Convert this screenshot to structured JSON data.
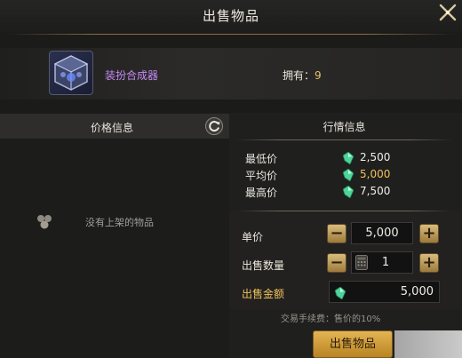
{
  "header": {
    "title": "出售物品"
  },
  "item": {
    "name": "装扮合成器",
    "own_label": "拥有：",
    "own_count": "9"
  },
  "left_panel": {
    "header": "价格信息",
    "empty_text": "没有上架的物品"
  },
  "market": {
    "header": "行情信息",
    "rows": [
      {
        "label": "最低价",
        "value": "2,500",
        "color": "#f2efe8"
      },
      {
        "label": "平均价",
        "value": "5,000",
        "color": "#f0c25a"
      },
      {
        "label": "最高价",
        "value": "7,500",
        "color": "#f2efe8"
      }
    ]
  },
  "sale": {
    "unit_price_label": "单价",
    "unit_price_value": "5,000",
    "quantity_label": "出售数量",
    "quantity_value": "1",
    "total_label": "出售金额",
    "total_value": "5,000",
    "minus": "−",
    "plus": "+"
  },
  "fee_text": "交易手续费：售价的10%",
  "sell_button": "出售物品",
  "colors": {
    "item_name": "#c58cf5",
    "gold": "#e6c068",
    "gem": "#4fd39a"
  }
}
